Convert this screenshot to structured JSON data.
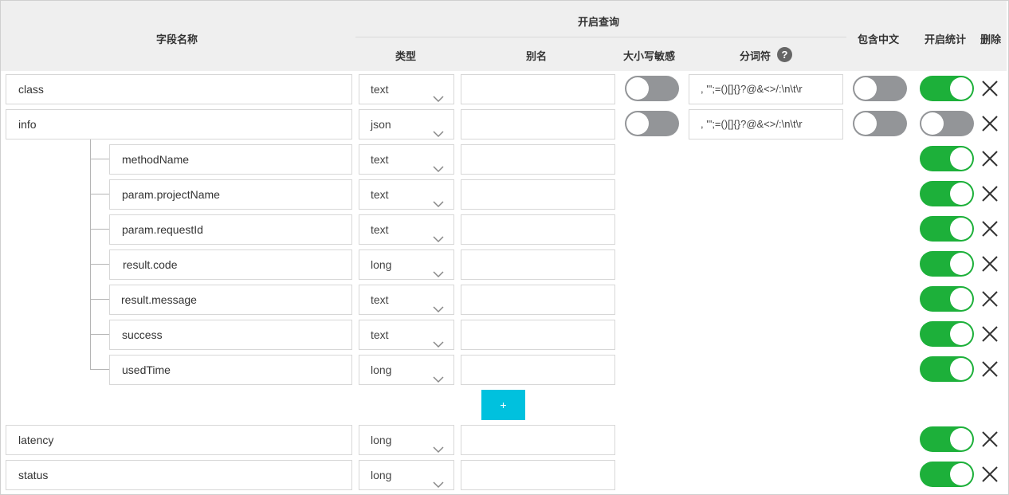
{
  "header": {
    "field_name": "字段名称",
    "query_group": "开启查询",
    "type": "类型",
    "alias": "别名",
    "case_sensitive": "大小写敏感",
    "tokenizer": "分词符",
    "tokenizer_help_icon": "?",
    "include_chinese": "包含中文",
    "enable_stats": "开启统计",
    "delete": "删除"
  },
  "rows": [
    {
      "name": "class",
      "type": "text",
      "alias": "",
      "case_sensitive": false,
      "tokenizer": ", '\";=()[]{}?@&<>/:\\n\\t\\r",
      "include_chinese": false,
      "stats": true
    },
    {
      "name": "info",
      "type": "json",
      "alias": "",
      "case_sensitive": false,
      "tokenizer": ", '\";=()[]{}?@&<>/:\\n\\t\\r",
      "include_chinese": false,
      "stats": false
    },
    {
      "name": "methodName",
      "type": "text",
      "alias": "",
      "stats": true
    },
    {
      "name": "param.projectName",
      "type": "text",
      "alias": "",
      "stats": true
    },
    {
      "name": "param.requestId",
      "type": "text",
      "alias": "",
      "stats": true
    },
    {
      "name": "result.code",
      "type": "long",
      "alias": "",
      "stats": true
    },
    {
      "name": "result.message",
      "type": "text",
      "alias": "",
      "stats": true
    },
    {
      "name": "success",
      "type": "text",
      "alias": "",
      "stats": true
    },
    {
      "name": "usedTime",
      "type": "long",
      "alias": "",
      "stats": true
    },
    {
      "name": "latency",
      "type": "long",
      "alias": "",
      "stats": true
    },
    {
      "name": "status",
      "type": "long",
      "alias": "",
      "stats": true
    }
  ],
  "add_button_label": "+",
  "icons": {
    "dropdown": "chevron-down-icon",
    "delete": "close-icon",
    "help": "question-circle-icon"
  },
  "colors": {
    "toggle_on": "#1db03a",
    "toggle_off": "#939598",
    "add_button": "#00c1de",
    "header_bg": "#efefef"
  }
}
